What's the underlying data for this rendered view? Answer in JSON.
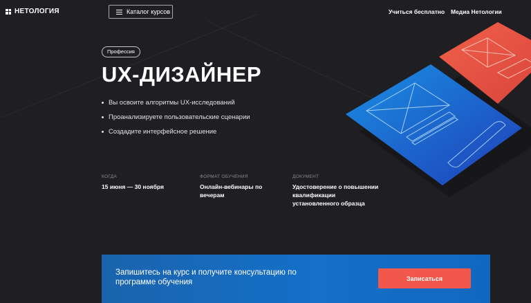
{
  "header": {
    "logo_text": "НЕТОЛОГИЯ",
    "catalog_button": "Каталог курсов",
    "links": [
      "Учиться бесплатно",
      "Медиа Нетологии"
    ]
  },
  "hero": {
    "badge": "Профессия",
    "title": "UX-ДИЗАЙНЕР",
    "bullets": [
      "Вы освоите алгоритмы UX-исследований",
      "Проанализируете пользовательские сценарии",
      "Создадите интерфейсное решение"
    ],
    "info": [
      {
        "label": "КОГДА",
        "value": "15 июня — 30 ноября"
      },
      {
        "label": "ФОРМАТ ОБУЧЕНИЯ",
        "value": "Онлайн-вебинары по вечерам"
      },
      {
        "label": "ДОКУМЕНТ",
        "value": "Удостоверение о повышении квалификации установленного образца"
      }
    ]
  },
  "cta": {
    "text": "Запишитесь на курс и получите консультацию по программе обучения",
    "button": "Записаться"
  },
  "colors": {
    "background": "#1f1f23",
    "accent_red": "#f1584b",
    "accent_blue": "#1470c8"
  }
}
